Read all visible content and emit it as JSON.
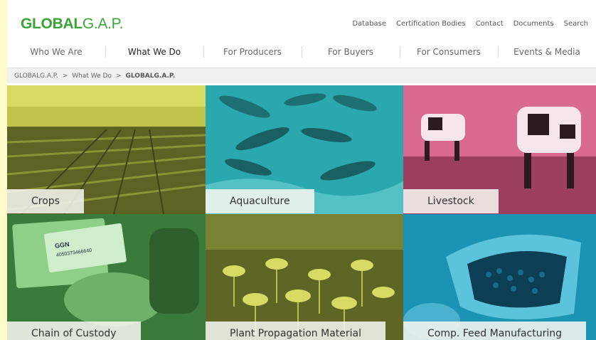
{
  "header": {
    "logo_bold": "GLOBAL",
    "logo_light": "G.A.P.",
    "utility_links": [
      "Database",
      "Certification Bodies",
      "Contact",
      "Documents",
      "Search"
    ]
  },
  "nav": {
    "items": [
      "Who We Are",
      "What We Do",
      "For Producers",
      "For Buyers",
      "For Consumers",
      "Events & Media"
    ],
    "active": "What We Do"
  },
  "breadcrumb": {
    "items": [
      "GLOBALG.A.P.",
      "What We Do"
    ],
    "current": "GLOBALG.A.P."
  },
  "tiles": [
    {
      "label": "Crops",
      "color": "#73782c"
    },
    {
      "label": "Aquaculture",
      "color": "#2aa8ad"
    },
    {
      "label": "Livestock",
      "color": "#c4557a"
    },
    {
      "label": "Chain of Custody",
      "color": "#3a7a3a",
      "card_text": "GGN",
      "card_number": "4050373466640"
    },
    {
      "label": "Plant Propagation Material",
      "color": "#5f6525"
    },
    {
      "label": "Comp. Feed Manufacturing",
      "color": "#1d93b4"
    }
  ],
  "colors": {
    "brand_green": "#3aa535",
    "page_margin": "#fdfbc9"
  }
}
